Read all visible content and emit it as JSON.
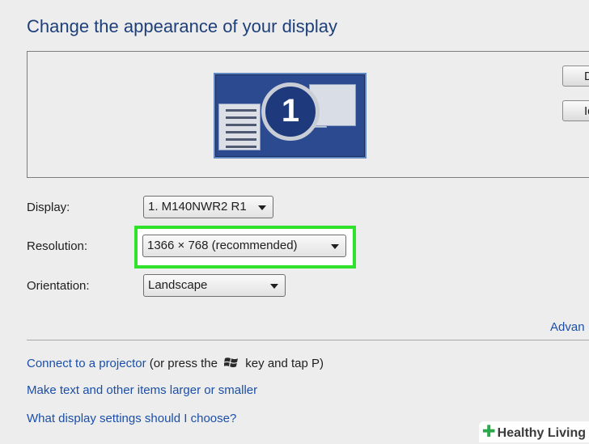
{
  "page": {
    "title": "Change the appearance of your display"
  },
  "preview": {
    "monitor_number": "1",
    "side_buttons": [
      "D",
      "Id"
    ]
  },
  "settings": {
    "display": {
      "label": "Display:",
      "value": "1. M140NWR2 R1"
    },
    "resolution": {
      "label": "Resolution:",
      "value": "1366 × 768 (recommended)"
    },
    "orientation": {
      "label": "Orientation:",
      "value": "Landscape"
    }
  },
  "advanced_link": "Advan",
  "links": {
    "projector": {
      "link_text": "Connect to a projector",
      "before_key": " (or press the",
      "after_key": " key and tap P)"
    },
    "text_size": "Make text and other items larger or smaller",
    "what_settings": "What display settings should I choose?"
  },
  "watermark": "Healthy Living",
  "colors": {
    "highlight": "#31e22c",
    "link": "#1b4fa8",
    "title": "#1d3f7a"
  }
}
